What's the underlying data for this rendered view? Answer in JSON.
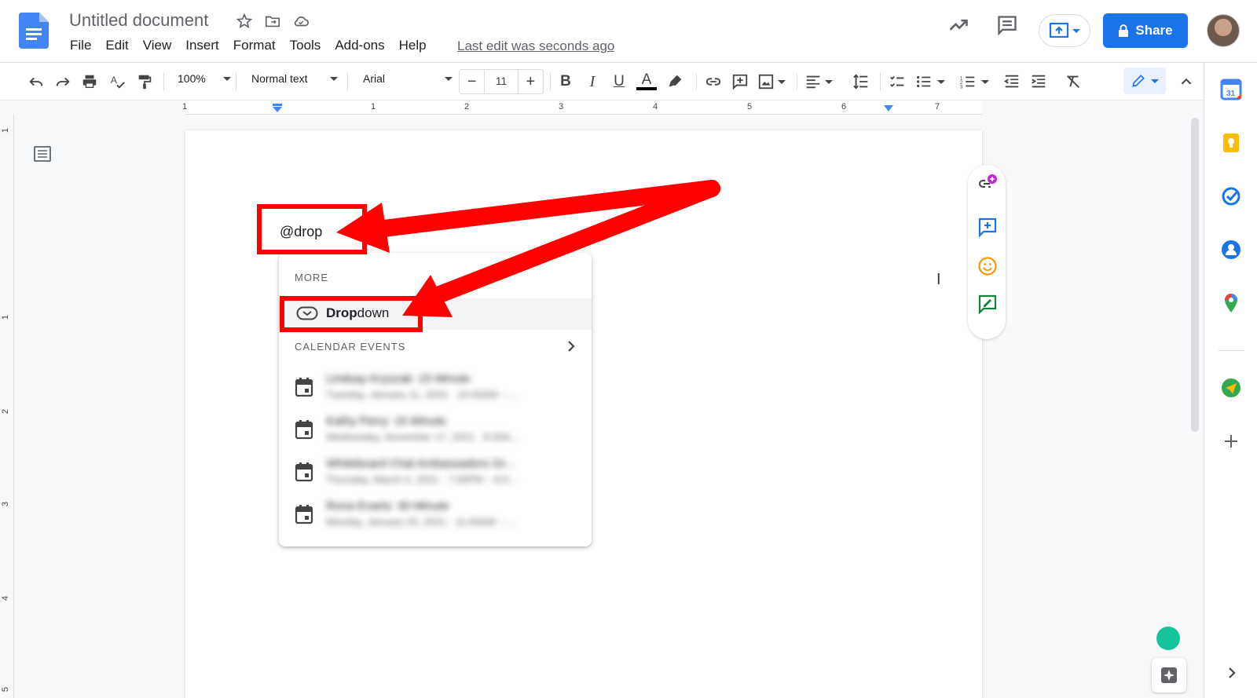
{
  "header": {
    "doc_title": "Untitled document",
    "menu": [
      "File",
      "Edit",
      "View",
      "Insert",
      "Format",
      "Tools",
      "Add-ons",
      "Help"
    ],
    "last_edit": "Last edit was seconds ago",
    "share_label": "Share"
  },
  "toolbar": {
    "zoom": "100%",
    "style": "Normal text",
    "font": "Arial",
    "font_size": "11",
    "minus": "−",
    "plus": "+"
  },
  "ruler": {
    "h_numbers": [
      "1",
      "1",
      "2",
      "3",
      "4",
      "5",
      "6",
      "7"
    ],
    "v_numbers": [
      "1",
      "1",
      "2",
      "3",
      "4",
      "5"
    ]
  },
  "document": {
    "typed_text": "@drop"
  },
  "popup": {
    "more_label": "MORE",
    "dropdown_bold": "Drop",
    "dropdown_rest": "down",
    "calendar_label": "CALENDAR EVENTS",
    "events": [
      {
        "title": "Lindsay Kryszak: 15 Minute",
        "date": "Tuesday, January 11, 2022 · 10:00AM – ..."
      },
      {
        "title": "Kathy Perry: 15 Minute",
        "date": "Wednesday, November 17, 2021 · 8:30A..."
      },
      {
        "title": "Whiteboard Chat Ambassadors Gr...",
        "date": "Thursday, March 4, 2021 · 7:00PM – 8:0..."
      },
      {
        "title": "Rona Evarts: 30 Minute",
        "date": "Monday, January 25, 2021 · 11:00AM – ..."
      }
    ]
  },
  "colors": {
    "accent": "#1a73e8",
    "annotation_red": "#ff0000"
  }
}
